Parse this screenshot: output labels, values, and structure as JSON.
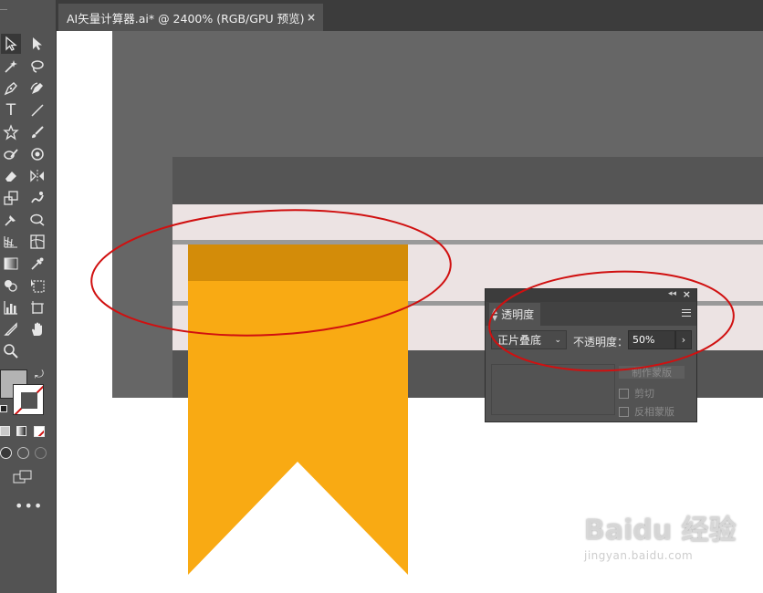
{
  "document_tab": {
    "title": "AI矢量计算器.ai* @ 2400% (RGB/GPU 预览)",
    "close": "×"
  },
  "toolbar": {
    "type_tool": "T",
    "more_tools": "•••",
    "fill_color": "#b3b3b3"
  },
  "transparency_panel": {
    "collapse": "◂◂",
    "close": "×",
    "tab_label": "透明度",
    "blend_mode": "正片叠底",
    "opacity_label": "不透明度：",
    "opacity_value": "50%",
    "more": "›",
    "make_mask": "制作蒙版",
    "clip_label": "剪切",
    "invert_mask_label": "反相蒙版"
  },
  "watermark": {
    "brand": "Baidu 经验",
    "url": "jingyan.baidu.com"
  },
  "colors": {
    "ui_dark": "#535353",
    "artwork_dark": "#666666",
    "panel_dark": "#555555",
    "light_stripe": "#ece3e3",
    "gray_line": "#999999",
    "ribbon": "#f9aa13",
    "ribbon_band": "#d38c09",
    "annotation": "#d01010"
  }
}
